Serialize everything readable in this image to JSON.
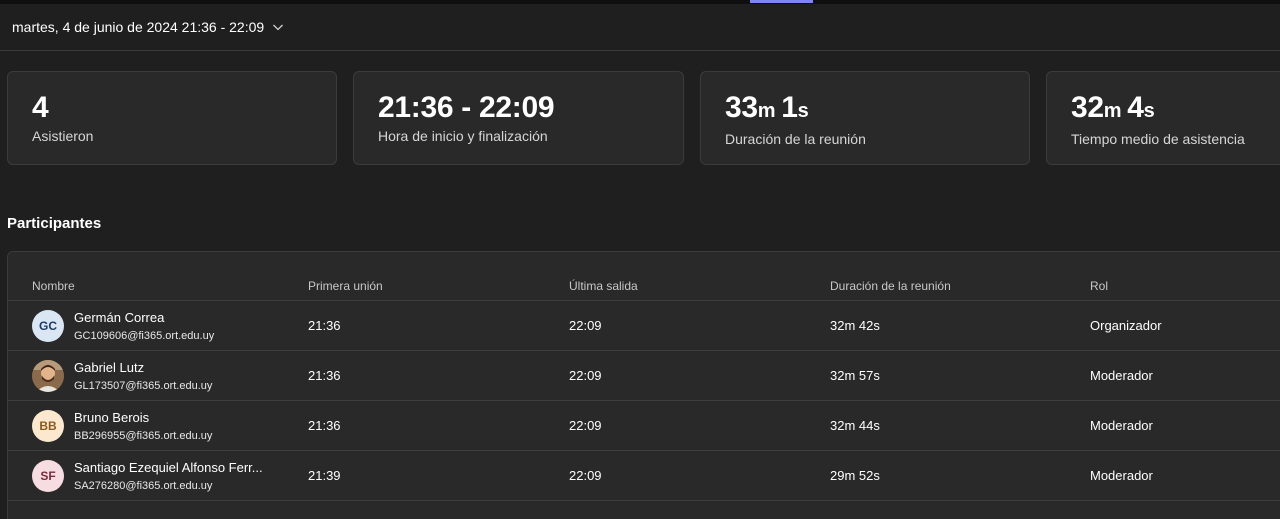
{
  "header": {
    "date_range": "martes, 4 de junio de 2024 21:36 - 22:09"
  },
  "stats": [
    {
      "value": "4",
      "label": "Asistieron"
    },
    {
      "value": "21:36 - 22:09",
      "label": "Hora de inicio y finalización"
    },
    {
      "value_min": "33",
      "unit_min": "m",
      "value_sec": "1",
      "unit_sec": "s",
      "label": "Duración de la reunión"
    },
    {
      "value_min": "32",
      "unit_min": "m",
      "value_sec": "4",
      "unit_sec": "s",
      "label": "Tiempo medio de asistencia"
    }
  ],
  "participants": {
    "title": "Participantes",
    "columns": [
      "Nombre",
      "Primera unión",
      "Última salida",
      "Duración de la reunión",
      "Rol"
    ],
    "rows": [
      {
        "initials": "GC",
        "avatar_bg": "#dbe6f5",
        "avatar_fg": "#1f3b63",
        "name": "Germán Correa",
        "email": "GC109606@fi365.ort.edu.uy",
        "first_join": "21:36",
        "last_leave": "22:09",
        "duration": "32m 42s",
        "role": "Organizador"
      },
      {
        "initials": "",
        "avatar_icon": "person-photo",
        "name": "Gabriel Lutz",
        "email": "GL173507@fi365.ort.edu.uy",
        "first_join": "21:36",
        "last_leave": "22:09",
        "duration": "32m 57s",
        "role": "Moderador"
      },
      {
        "initials": "BB",
        "avatar_bg": "#fbe8cf",
        "avatar_fg": "#8a5a1c",
        "name": "Bruno Berois",
        "email": "BB296955@fi365.ort.edu.uy",
        "first_join": "21:36",
        "last_leave": "22:09",
        "duration": "32m 44s",
        "role": "Moderador"
      },
      {
        "initials": "SF",
        "avatar_bg": "#f6dde2",
        "avatar_fg": "#7a2a3a",
        "name": "Santiago Ezequiel Alfonso Ferr...",
        "email": "SA276280@fi365.ort.edu.uy",
        "first_join": "21:39",
        "last_leave": "22:09",
        "duration": "29m 52s",
        "role": "Moderador"
      }
    ]
  },
  "colors": {
    "background": "#1f1f1f",
    "card": "#292929",
    "accent": "#7f85f5"
  }
}
